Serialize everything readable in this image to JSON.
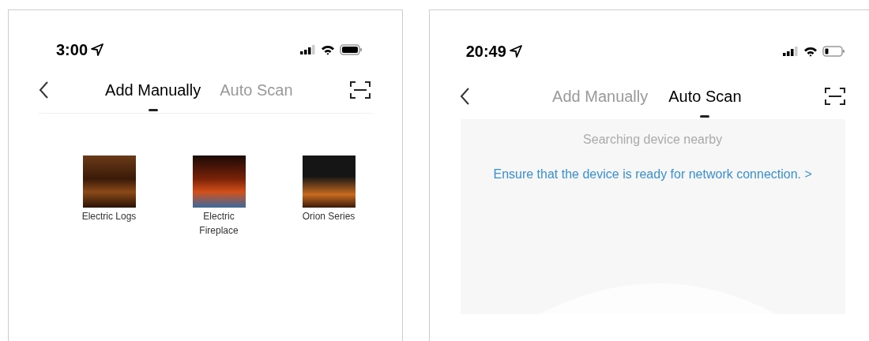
{
  "screens": [
    {
      "kind": "manual",
      "status_bar": {
        "time": "3:00",
        "battery_low": false
      },
      "tabs": [
        {
          "label": "Add Manually",
          "selected": true
        },
        {
          "label": "Auto Scan",
          "selected": false
        }
      ],
      "devices": [
        {
          "label": "Electric Logs"
        },
        {
          "label": "Electric Fireplace"
        },
        {
          "label": "Orion Series"
        }
      ]
    },
    {
      "kind": "scan",
      "status_bar": {
        "time": "20:49",
        "battery_low": true
      },
      "tabs": [
        {
          "label": "Add Manually",
          "selected": false
        },
        {
          "label": "Auto Scan",
          "selected": true
        }
      ],
      "status_text": "Searching device nearby",
      "link": "Ensure that the device is ready for network connection. >"
    }
  ]
}
